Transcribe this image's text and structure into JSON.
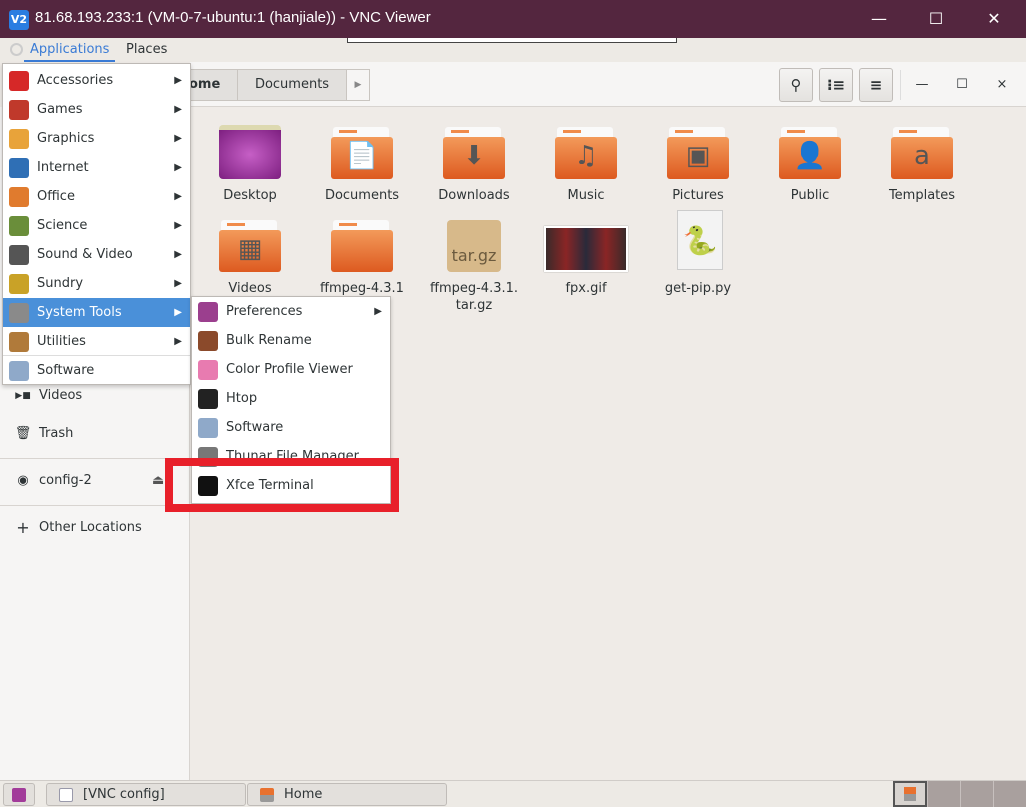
{
  "window": {
    "title": "81.68.193.233:1 (VM-0-7-ubuntu:1 (hanjiale)) - VNC Viewer",
    "logo": "V2",
    "minimize": "—",
    "maximize": "☐",
    "close": "✕"
  },
  "panel": {
    "applications": "Applications",
    "places": "Places"
  },
  "header": {
    "breadcrumbs": [
      "ome",
      "Documents"
    ],
    "search_icon": "search-icon",
    "view_icon": "list-view-icon",
    "menu_icon": "hamburger-icon",
    "minimize": "—",
    "maximize": "☐",
    "close": "×"
  },
  "sidebar": {
    "items": [
      {
        "label": "Videos",
        "icon": "▶■"
      },
      {
        "label": "Trash",
        "icon": "🗑"
      },
      {
        "label": "config-2",
        "icon": "◉",
        "eject": "⏏"
      },
      {
        "label": "Other Locations",
        "icon": "+"
      }
    ]
  },
  "files": [
    {
      "label": "Desktop",
      "type": "desktop"
    },
    {
      "label": "Documents",
      "type": "folder",
      "glyph": "📄"
    },
    {
      "label": "Downloads",
      "type": "folder",
      "glyph": "⬇"
    },
    {
      "label": "Music",
      "type": "folder",
      "glyph": "♫"
    },
    {
      "label": "Pictures",
      "type": "folder",
      "glyph": "▣"
    },
    {
      "label": "Public",
      "type": "folder",
      "glyph": "👤"
    },
    {
      "label": "Templates",
      "type": "folder",
      "glyph": "a"
    },
    {
      "label": "Videos",
      "type": "folder",
      "glyph": "▦"
    },
    {
      "label": "ffmpeg-4.3.1",
      "type": "folder",
      "glyph": ""
    },
    {
      "label": "ffmpeg-4.3.1.\ntar.gz",
      "type": "archive",
      "glyph": "tar.gz"
    },
    {
      "label": "fpx.gif",
      "type": "image"
    },
    {
      "label": "get-pip.py",
      "type": "python"
    }
  ],
  "app_menu": {
    "items": [
      {
        "label": "Accessories",
        "color": "#d62828"
      },
      {
        "label": "Games",
        "color": "#c0392b"
      },
      {
        "label": "Graphics",
        "color": "#e8a33a"
      },
      {
        "label": "Internet",
        "color": "#2f6fb5"
      },
      {
        "label": "Office",
        "color": "#e07b2e"
      },
      {
        "label": "Science",
        "color": "#6a8e3a"
      },
      {
        "label": "Sound & Video",
        "color": "#555555"
      },
      {
        "label": "Sundry",
        "color": "#c9a227"
      },
      {
        "label": "System Tools",
        "color": "#8a8a8a",
        "highlighted": true
      },
      {
        "label": "Utilities",
        "color": "#b07a3a"
      },
      {
        "label": "Software",
        "color": "#8fa9c9"
      }
    ]
  },
  "submenu": {
    "items": [
      {
        "label": "Preferences",
        "color": "#9b3f8e",
        "arrow": true
      },
      {
        "label": "Bulk Rename",
        "color": "#8b4a2b"
      },
      {
        "label": "Color Profile Viewer",
        "color": "#e87bb0"
      },
      {
        "label": "Htop",
        "color": "#222222"
      },
      {
        "label": "Software",
        "color": "#8fa9c9"
      },
      {
        "label": "Thunar File Manager",
        "color": "#777777"
      },
      {
        "label": "Xfce Terminal",
        "color": "#111111"
      }
    ]
  },
  "taskbar": {
    "tasks": [
      "[VNC config]",
      "Home"
    ]
  },
  "colors": {
    "titlebar": "#54263f",
    "highlight": "#4a90d9",
    "annotation": "#e8202a",
    "folder": "#e8712f"
  }
}
